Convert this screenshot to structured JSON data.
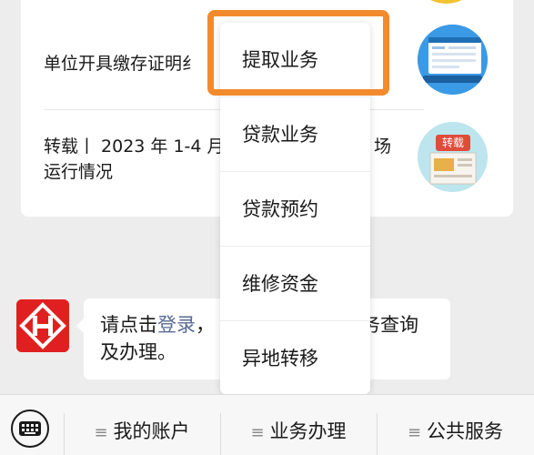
{
  "articles": [
    {
      "title": "单位开具缴存证明纟",
      "title_suffix": ""
    },
    {
      "title": "转载丨 2023 年 1-4 月",
      "title_line2": "运行情况",
      "title_tail": "场"
    }
  ],
  "popup_menu": {
    "items": [
      {
        "label": "提取业务",
        "highlighted": true
      },
      {
        "label": "贷款业务"
      },
      {
        "label": "贷款预约"
      },
      {
        "label": "维修资金"
      },
      {
        "label": "异地转移"
      }
    ]
  },
  "chat": {
    "text_before_link": "请点击",
    "link_text": "登录",
    "text_after_link": "，",
    "text_tail": "务查询",
    "text_line2": "及办理。"
  },
  "thumbnail_badge": "转载",
  "bottom_menu": {
    "items": [
      {
        "label": "我的账户",
        "icon": "menu-lines-icon"
      },
      {
        "label": "业务办理",
        "icon": "menu-lines-icon"
      },
      {
        "label": "公共服务",
        "icon": "menu-lines-icon"
      }
    ],
    "menu_glyph": "≡"
  },
  "colors": {
    "highlight": "#f28a2e",
    "brand_red": "#e02020",
    "link": "#576b95"
  }
}
